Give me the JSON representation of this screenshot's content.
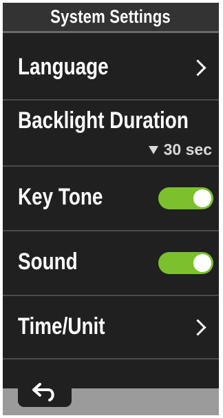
{
  "header": {
    "title": "System Settings"
  },
  "settings": {
    "language": {
      "label": "Language",
      "icon": "chevron-right-icon"
    },
    "backlight": {
      "label": "Backlight Duration",
      "value": "30 sec",
      "icon": "dropdown-triangle-icon"
    },
    "key_tone": {
      "label": "Key Tone",
      "enabled": true
    },
    "sound": {
      "label": "Sound",
      "enabled": true
    },
    "time_unit": {
      "label": "Time/Unit",
      "icon": "chevron-right-icon"
    }
  },
  "footer": {
    "back_icon": "back-arrow-icon"
  },
  "colors": {
    "background": "#202020",
    "title_bar": "#333333",
    "divider": "#4b4b4b",
    "toggle_on": "#7bc12e",
    "footer": "#9b9b9b",
    "text": "#ffffff"
  }
}
